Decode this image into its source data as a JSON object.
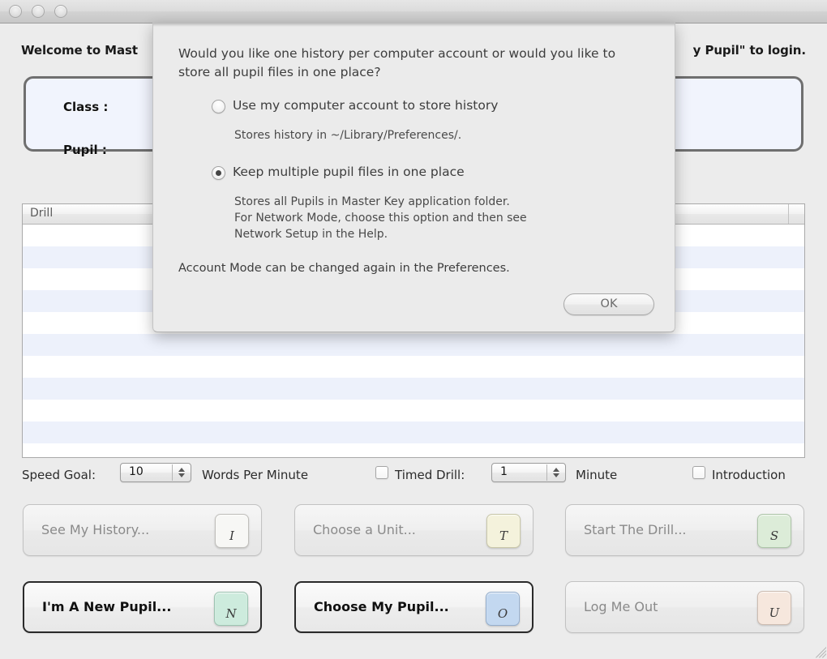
{
  "window": {
    "traffic_lights": [
      "close",
      "minimize",
      "zoom"
    ],
    "welcome_head": "Welcome to Mast",
    "welcome_tail": "y Pupil\" to login."
  },
  "info_panel": {
    "class_label": "Class :",
    "pupil_label": "Pupil :"
  },
  "table": {
    "columns": [
      "Drill",
      ""
    ],
    "rows": [
      "",
      "",
      "",
      "",
      "",
      "",
      "",
      "",
      "",
      "",
      ""
    ]
  },
  "options": {
    "speed_goal_label": "Speed Goal:",
    "speed_goal_value": "10",
    "words_per_minute_label": "Words Per Minute",
    "timed_drill_label": "Timed Drill:",
    "timed_drill_checked": false,
    "timed_drill_value": "1",
    "minute_label": "Minute",
    "introduction_label": "Introduction",
    "introduction_checked": false
  },
  "actions": [
    {
      "label": "See My History...",
      "key": "I",
      "enabled": false,
      "key_color": "#f7f7f5",
      "key_border": "#c0bfbb"
    },
    {
      "label": "Choose a Unit...",
      "key": "T",
      "enabled": false,
      "key_color": "#f4f2dc",
      "key_border": "#c9c7a8"
    },
    {
      "label": "Start The Drill...",
      "key": "S",
      "enabled": false,
      "key_color": "#dcecd8",
      "key_border": "#adc5a8"
    },
    {
      "label": "I'm A New Pupil...",
      "key": "N",
      "enabled": true,
      "key_color": "#cdebdd",
      "key_border": "#9dc4b2"
    },
    {
      "label": "Choose My Pupil...",
      "key": "O",
      "enabled": true,
      "key_color": "#c3d8f0",
      "key_border": "#94aecd"
    },
    {
      "label": "Log Me Out",
      "key": "U",
      "enabled": false,
      "key_color": "#f6e7dd",
      "key_border": "#cdbcb1"
    }
  ],
  "dialog": {
    "question": "Would you like one history per computer account or would you like to store all pupil files in one place?",
    "option_1": {
      "label": "Use my computer account to store history",
      "selected": false,
      "description": "Stores history in ~/Library/Preferences/."
    },
    "option_2": {
      "label": "Keep multiple pupil files in one place",
      "selected": true,
      "description": "Stores all Pupils in Master Key application folder.\nFor Network Mode, choose this option and then see\nNetwork Setup in the Help."
    },
    "note": "Account Mode can be changed again in the Preferences.",
    "ok_label": "OK"
  },
  "colors": {
    "window_bg": "#ececec",
    "sheet_bg": "#ebebeb",
    "panel_bg": "#f1f4fd",
    "row_alt": "#edf1fb",
    "text": "#3d3d3d",
    "disabled_text": "#8a8a8a"
  }
}
